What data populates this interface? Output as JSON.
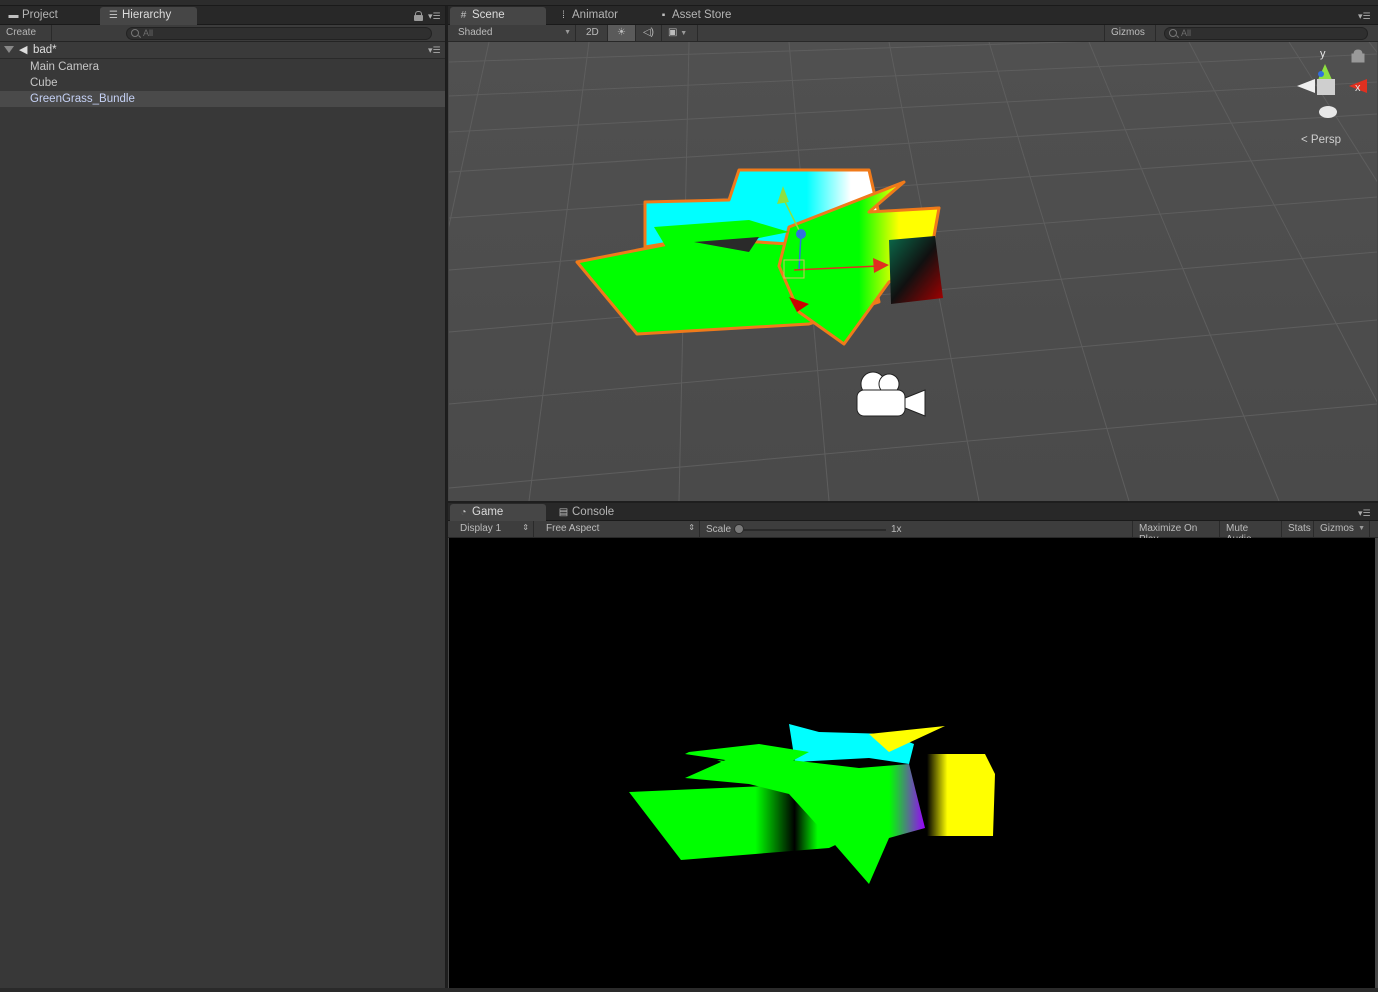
{
  "hierarchy_panel": {
    "tabs": [
      {
        "label": "Project",
        "icon": "folder-icon"
      },
      {
        "label": "Hierarchy",
        "icon": "hierarchy-list-icon"
      }
    ],
    "create_label": "Create",
    "search_placeholder": "All",
    "scene_name": "bad*",
    "items": [
      {
        "label": "Main Camera"
      },
      {
        "label": "Cube"
      },
      {
        "label": "GreenGrass_Bundle",
        "selected": true
      }
    ]
  },
  "scene_panel": {
    "tabs": [
      {
        "label": "Scene",
        "icon": "grid-icon"
      },
      {
        "label": "Animator",
        "icon": "animator-icon"
      },
      {
        "label": "Asset Store",
        "icon": "store-bag-icon"
      }
    ],
    "shading_mode": "Shaded",
    "mode_2d": "2D",
    "gizmos_label": "Gizmos",
    "search_placeholder": "All",
    "orientation": {
      "y": "y",
      "x": "x",
      "projection": "Persp"
    }
  },
  "game_panel": {
    "tabs": [
      {
        "label": "Game",
        "icon": "pacman-icon"
      },
      {
        "label": "Console",
        "icon": "console-icon"
      }
    ],
    "display": "Display 1",
    "aspect": "Free Aspect",
    "scale_label": "Scale",
    "scale_value": "1x",
    "scale_fraction": 0.0,
    "maximize_label": "Maximize On Play",
    "mute_label": "Mute Audio",
    "stats_label": "Stats",
    "gizmos_label": "Gizmos"
  },
  "colors": {
    "selection_outline": "#f07a1a",
    "selected_text": "#c5d1f5",
    "grass_green": "#00ff00",
    "grass_cyan": "#00ffff",
    "grass_yellow": "#ffff00",
    "gizmo_x": "#e03020",
    "gizmo_y": "#8ee040",
    "gizmo_z": "#3070e0"
  }
}
